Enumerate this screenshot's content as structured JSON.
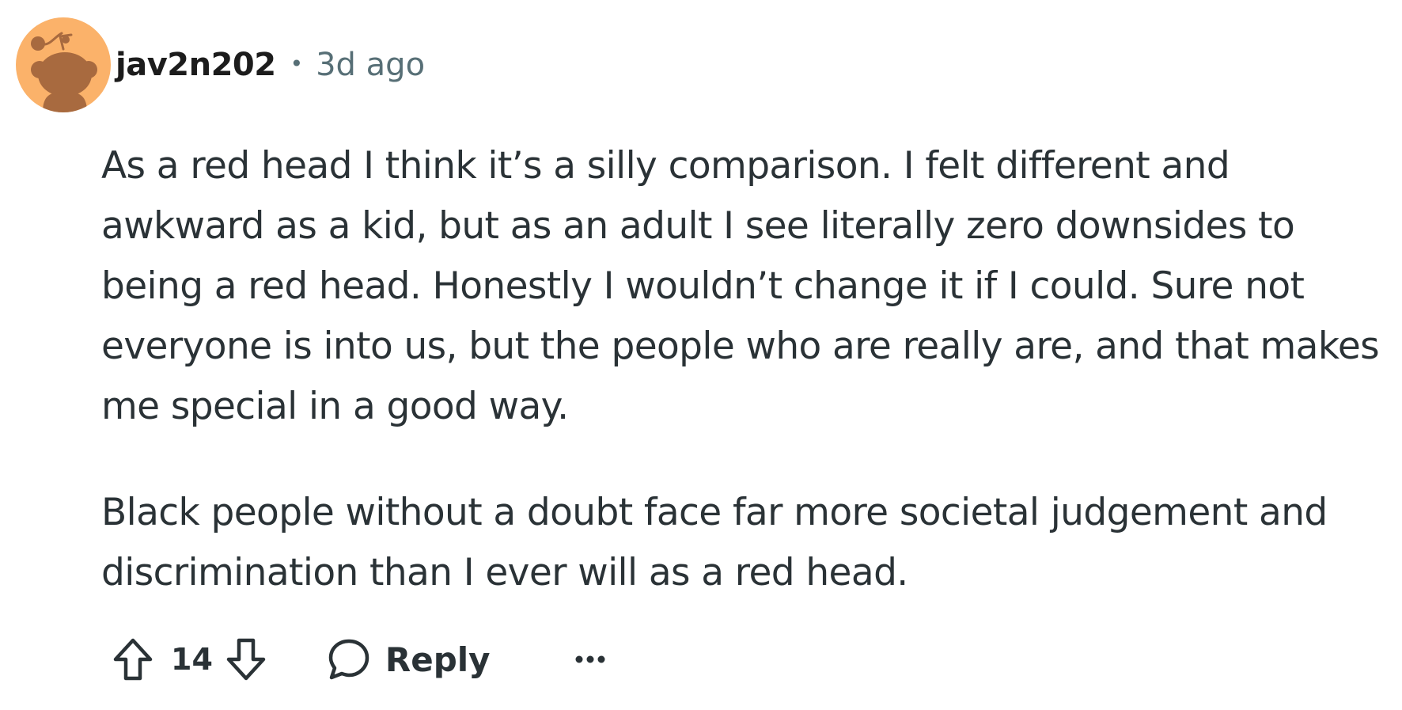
{
  "comment": {
    "author": "jav2n202",
    "separator": "•",
    "timestamp": "3d ago",
    "paragraphs": [
      "As a red head I think it’s a silly comparison. I felt different and awkward as a kid, but as an adult I see literally zero downsides to being a red head. Honestly I wouldn’t change it if I could. Sure not everyone is into us, but the people who are really are, and that makes me special in a good way.",
      "Black people without a doubt face far more societal judgement and discrimination than I ever will as a red head."
    ],
    "score": "14",
    "reply_label": "Reply",
    "icons": {
      "avatar": "snoo-avatar-icon",
      "upvote": "upvote-arrow-icon",
      "downvote": "downvote-arrow-icon",
      "reply": "speech-bubble-icon",
      "more": "ellipsis-icon"
    }
  },
  "colors": {
    "avatar_background": "#fbb26a",
    "avatar_snoo": "#a86a3f",
    "text": "#2a3236",
    "meta": "#576f76",
    "username": "#1c1c1c"
  }
}
